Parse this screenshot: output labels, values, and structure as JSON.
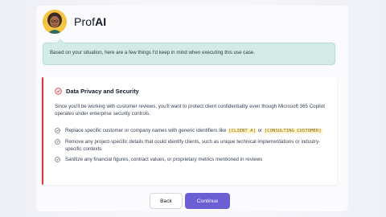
{
  "brand": {
    "prefix": "Prof",
    "suffix": "AI"
  },
  "notice": {
    "text": "Based on your situation, here are a few things I'd keep in mind when executing this use case."
  },
  "card": {
    "title": "Data Privacy and Security",
    "intro": "Since you'll be working with customer reviews, you'll want to protect client confidentiality even though Microsoft 365 Copilot operates under enterprise security controls.",
    "items": [
      {
        "text_before": "Replace specific customer or company names with generic identifiers like ",
        "code1": "[CLIENT A]",
        "mid": " or ",
        "code2": "[CONSULTING CUSTOMER]"
      },
      {
        "text": "Remove any project-specific details that could identify clients, such as unique technical implementations or industry-specific contexts"
      },
      {
        "text": "Sanitize any financial figures, contract values, or proprietary metrics mentioned in reviews"
      }
    ]
  },
  "buttons": {
    "back": "Back",
    "continue": "Continue"
  },
  "colors": {
    "accent": "#6b5fd3",
    "alert": "#d9363e",
    "notice_bg": "#d3ebe5"
  }
}
